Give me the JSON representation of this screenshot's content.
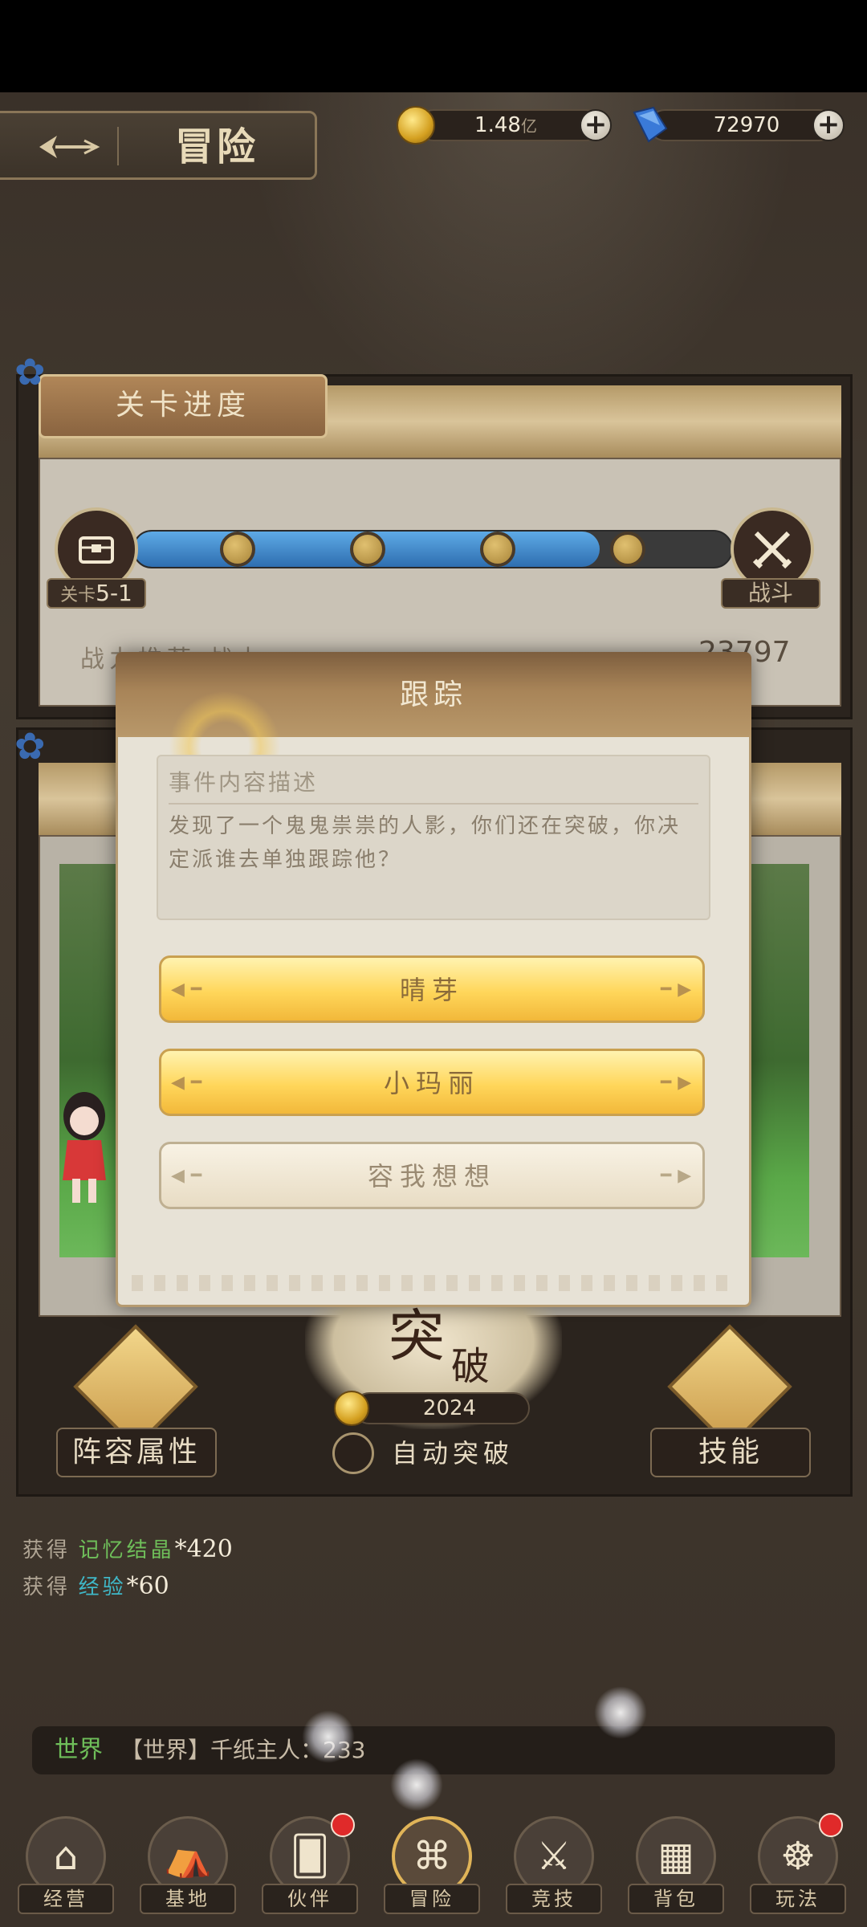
{
  "header": {
    "title": "冒险",
    "coins": {
      "value": "1.48",
      "unit": "亿"
    },
    "gems": {
      "value": "72970"
    }
  },
  "stage_panel": {
    "title": "关卡进度",
    "stage_label": "关卡",
    "stage_number": "5-1",
    "battle_label": "战斗",
    "power_left": "战力推荐 战力",
    "power_value": "23797",
    "progress_fraction": 0.78
  },
  "modal": {
    "title": "跟踪",
    "desc_heading": "事件内容描述",
    "desc_text": "发现了一个鬼鬼祟祟的人影，你们还在突破，你决定派谁去单独跟踪他？",
    "choices": [
      "晴芽",
      "小玛丽",
      "容我想想"
    ]
  },
  "bottom_panel": {
    "lineup_label": "阵容属性",
    "skill_label": "技能",
    "breakthrough_big": "突",
    "breakthrough_small": "破",
    "breakthrough_cost": "2024",
    "auto_label": "自动突破"
  },
  "log": {
    "line1_prefix": "获得",
    "line1_item": "记忆结晶",
    "line1_count": "*420",
    "line2_prefix": "获得",
    "line2_item": "经验",
    "line2_count": "*60"
  },
  "chat": {
    "channel": "世界",
    "message": "【世界】千纸主人：233"
  },
  "nav": [
    {
      "label": "经营",
      "icon": "house-icon",
      "badge": false
    },
    {
      "label": "基地",
      "icon": "tent-icon",
      "badge": false
    },
    {
      "label": "伙伴",
      "icon": "cards-icon",
      "badge": true
    },
    {
      "label": "冒险",
      "icon": "map-icon",
      "badge": false
    },
    {
      "label": "竞技",
      "icon": "crossed-swords-icon",
      "badge": false
    },
    {
      "label": "背包",
      "icon": "backpack-icon",
      "badge": false
    },
    {
      "label": "玩法",
      "icon": "ship-wheel-icon",
      "badge": true
    }
  ],
  "colors": {
    "accent_gold": "#ffd65a",
    "progress_blue": "#3e86cc",
    "log_green": "#6fbf5a",
    "log_cyan": "#3fb8c8",
    "badge_red": "#e02a2a"
  }
}
